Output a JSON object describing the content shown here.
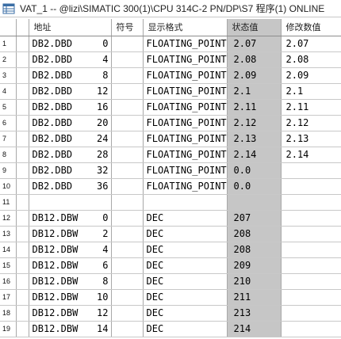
{
  "window": {
    "title": "VAT_1 -- @lizi\\SIMATIC 300(1)\\CPU 314C-2 PN/DP\\S7 程序(1)  ONLINE"
  },
  "table": {
    "headers": {
      "address": "地址",
      "symbol": "符号",
      "display_format": "显示格式",
      "status_value": "状态值",
      "modify_value": "修改数值"
    },
    "rows": [
      {
        "num": "1",
        "addr": "DB2.DBD",
        "offset": "0",
        "format": "FLOATING_POINT",
        "status": "2.07",
        "modify": "2.07"
      },
      {
        "num": "2",
        "addr": "DB2.DBD",
        "offset": "4",
        "format": "FLOATING_POINT",
        "status": "2.08",
        "modify": "2.08"
      },
      {
        "num": "3",
        "addr": "DB2.DBD",
        "offset": "8",
        "format": "FLOATING_POINT",
        "status": "2.09",
        "modify": "2.09"
      },
      {
        "num": "4",
        "addr": "DB2.DBD",
        "offset": "12",
        "format": "FLOATING_POINT",
        "status": "2.1",
        "modify": "2.1"
      },
      {
        "num": "5",
        "addr": "DB2.DBD",
        "offset": "16",
        "format": "FLOATING_POINT",
        "status": "2.11",
        "modify": "2.11"
      },
      {
        "num": "6",
        "addr": "DB2.DBD",
        "offset": "20",
        "format": "FLOATING_POINT",
        "status": "2.12",
        "modify": "2.12"
      },
      {
        "num": "7",
        "addr": "DB2.DBD",
        "offset": "24",
        "format": "FLOATING_POINT",
        "status": "2.13",
        "modify": "2.13"
      },
      {
        "num": "8",
        "addr": "DB2.DBD",
        "offset": "28",
        "format": "FLOATING_POINT",
        "status": "2.14",
        "modify": "2.14"
      },
      {
        "num": "9",
        "addr": "DB2.DBD",
        "offset": "32",
        "format": "FLOATING_POINT",
        "status": "0.0",
        "modify": ""
      },
      {
        "num": "10",
        "addr": "DB2.DBD",
        "offset": "36",
        "format": "FLOATING_POINT",
        "status": "0.0",
        "modify": ""
      },
      {
        "num": "11",
        "addr": "",
        "offset": "",
        "format": "",
        "status": "",
        "modify": ""
      },
      {
        "num": "12",
        "addr": "DB12.DBW",
        "offset": "0",
        "format": "DEC",
        "status": "207",
        "modify": ""
      },
      {
        "num": "13",
        "addr": "DB12.DBW",
        "offset": "2",
        "format": "DEC",
        "status": "208",
        "modify": ""
      },
      {
        "num": "14",
        "addr": "DB12.DBW",
        "offset": "4",
        "format": "DEC",
        "status": "208",
        "modify": ""
      },
      {
        "num": "15",
        "addr": "DB12.DBW",
        "offset": "6",
        "format": "DEC",
        "status": "209",
        "modify": ""
      },
      {
        "num": "16",
        "addr": "DB12.DBW",
        "offset": "8",
        "format": "DEC",
        "status": "210",
        "modify": ""
      },
      {
        "num": "17",
        "addr": "DB12.DBW",
        "offset": "10",
        "format": "DEC",
        "status": "211",
        "modify": ""
      },
      {
        "num": "18",
        "addr": "DB12.DBW",
        "offset": "12",
        "format": "DEC",
        "status": "213",
        "modify": ""
      },
      {
        "num": "19",
        "addr": "DB12.DBW",
        "offset": "14",
        "format": "DEC",
        "status": "214",
        "modify": ""
      }
    ]
  },
  "icons": {
    "app": "variable-table-icon"
  }
}
